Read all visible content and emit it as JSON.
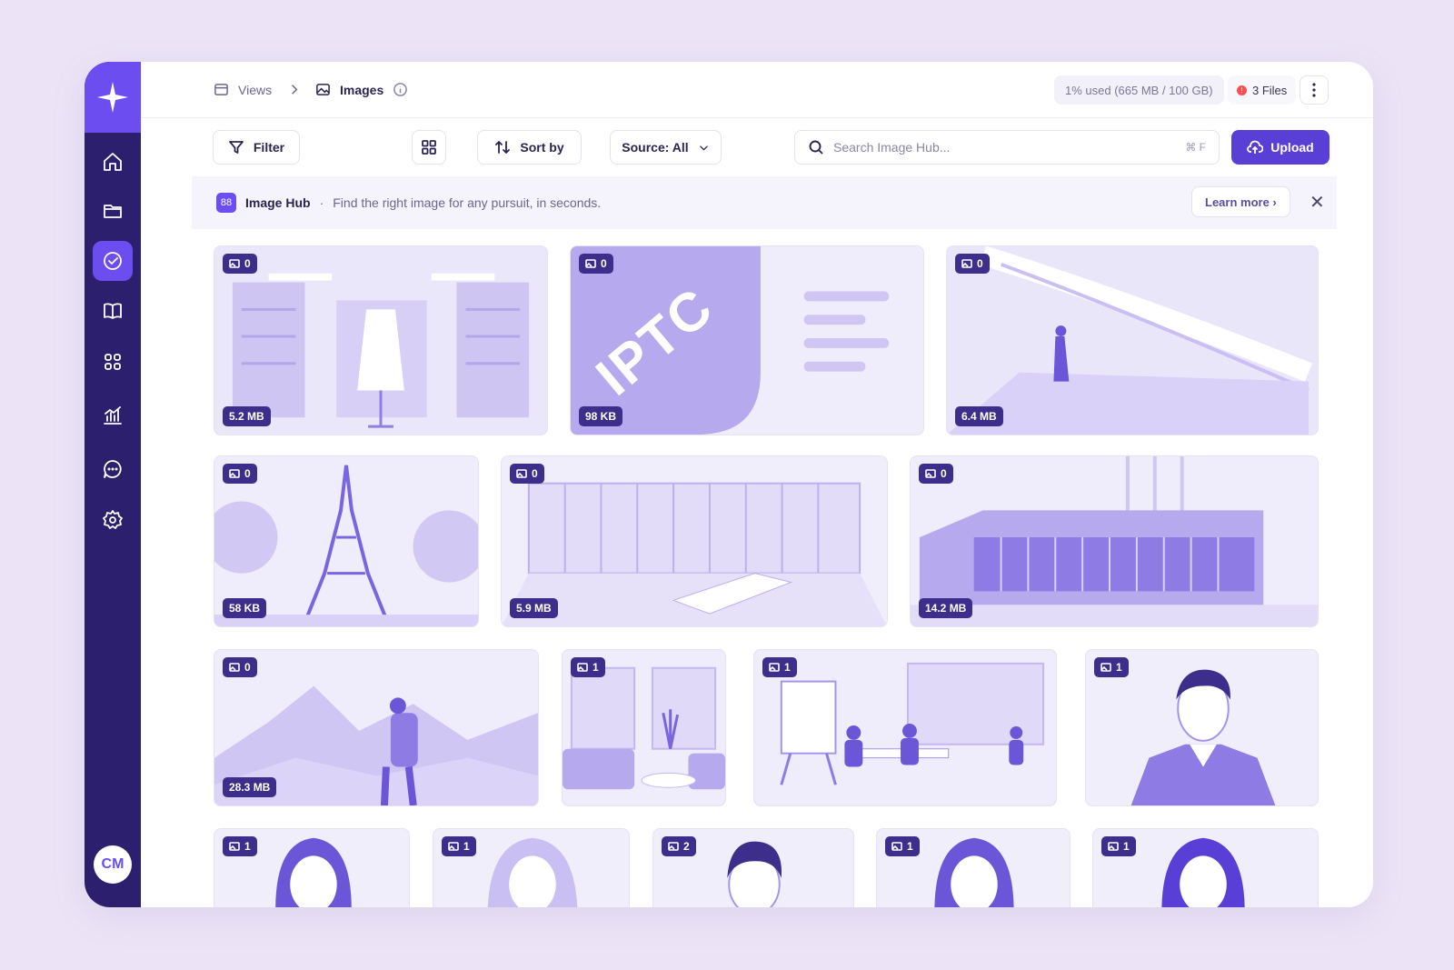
{
  "breadcrumb": {
    "views": "Views",
    "images": "Images"
  },
  "storage": {
    "usage": "1% used (665 MB / 100 GB)",
    "files": "3 Files",
    "files_alert": "!"
  },
  "toolbar": {
    "filter": "Filter",
    "sort": "Sort by",
    "source": "Source: All",
    "search_placeholder": "Search Image Hub...",
    "search_shortcut": "⌘ F",
    "upload": "Upload"
  },
  "banner": {
    "icon": "88",
    "title": "Image Hub",
    "separator": "·",
    "description": "Find the right image for any pursuit, in seconds.",
    "learn_more": "Learn more ›",
    "close": "✕"
  },
  "user": {
    "initials": "CM"
  },
  "colors": {
    "accent": "#6b4df0",
    "sidebar": "#2c1f6e",
    "button": "#5a3fd6",
    "badge": "#3d2e8c"
  },
  "tiles": [
    {
      "count": "0",
      "size": "5.2 MB",
      "scene": "boutique-interior"
    },
    {
      "count": "0",
      "size": "98 KB",
      "scene": "iptc-logo",
      "text": "IPTC"
    },
    {
      "count": "0",
      "size": "6.4 MB",
      "scene": "modern-corridor"
    },
    {
      "count": "0",
      "size": "58 KB",
      "scene": "eiffel-tower"
    },
    {
      "count": "0",
      "size": "5.9 MB",
      "scene": "empty-office"
    },
    {
      "count": "0",
      "size": "14.2 MB",
      "scene": "modern-building"
    },
    {
      "count": "0",
      "size": "28.3 MB",
      "scene": "mountain-hiker"
    },
    {
      "count": "1",
      "scene": "living-room"
    },
    {
      "count": "1",
      "scene": "meeting-room"
    },
    {
      "count": "1",
      "scene": "man-portrait"
    },
    {
      "count": "1",
      "scene": "woman-portrait"
    },
    {
      "count": "1",
      "scene": "woman-portrait"
    },
    {
      "count": "2",
      "scene": "man-portrait"
    },
    {
      "count": "1",
      "scene": "woman-portrait"
    },
    {
      "count": "1",
      "scene": "woman-portrait"
    }
  ]
}
